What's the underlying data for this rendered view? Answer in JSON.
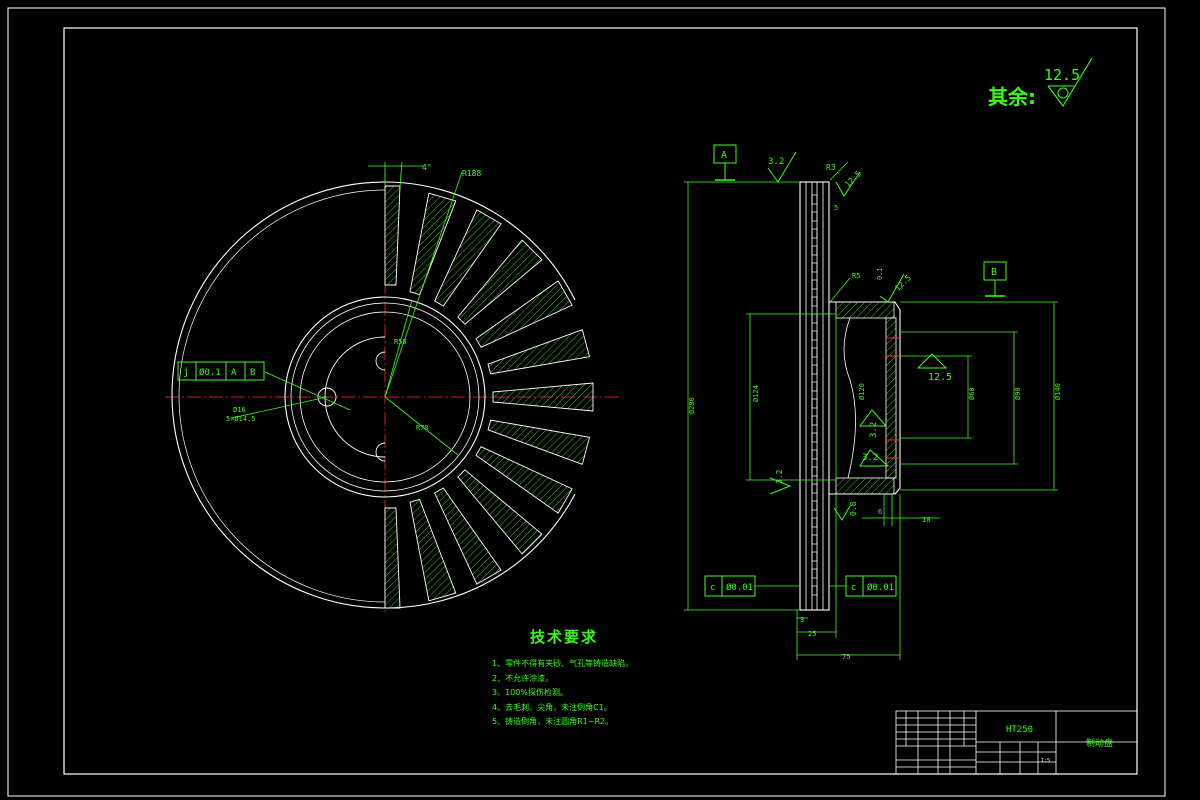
{
  "roughness": {
    "label": "其余:",
    "value": "12.5"
  },
  "datums": {
    "a": "A",
    "b": "B"
  },
  "front_view": {
    "angle": "4°",
    "radius_outer": "R188",
    "radius_inner": "R58",
    "radius_70": "R70",
    "hole_dia": "Ø16",
    "hole_pattern": "5×Ø14.5",
    "position_tol": {
      "symbol": "j",
      "tol": "Ø0.1",
      "ref_a": "A",
      "ref_b": "B"
    }
  },
  "section_view": {
    "rough_top": "3.2",
    "rough_top_right": "12.5",
    "rough_hub": "12.5",
    "rough_hub_top": "12.5",
    "rough_bore_a": "3.2",
    "rough_bore_b": "3.2",
    "rough_left": "3.2",
    "chamfer_r3": "R3",
    "chamfer_r5": "R5",
    "small_5": "5",
    "small_01": "0.1",
    "small_08": "0.8",
    "dia_total": "Ø280",
    "dia_124": "Ø124",
    "dia_120": "Ø120",
    "dia_60": "Ø60",
    "dia_90": "Ø90",
    "dia_140": "Ø140",
    "dim_6": "6",
    "dim_10": "10",
    "dim_3": "3",
    "dim_25": "25",
    "dim_75": "75",
    "flat_tol_left": {
      "symbol": "c",
      "tol": "Ø0.01"
    },
    "flat_tol_right": {
      "symbol": "c",
      "tol": "Ø0.01"
    }
  },
  "notes": {
    "title": "技术要求",
    "items": [
      "1、零件不得有夹砂、气孔等铸造缺陷。",
      "2、不允许涂漆。",
      "3、100%探伤检测。",
      "4、去毛刺、尖角，未注倒角C1。",
      "5、铸造倒角，未注圆角R1~R2。"
    ]
  },
  "title_block": {
    "part_code": "HT250",
    "part_name": "制动盘",
    "scale": "1:5"
  },
  "colors": {
    "geometry": "#ffffff",
    "dimension": "#39ff14",
    "centerline": "#ff2a2a",
    "background": "#000000"
  }
}
